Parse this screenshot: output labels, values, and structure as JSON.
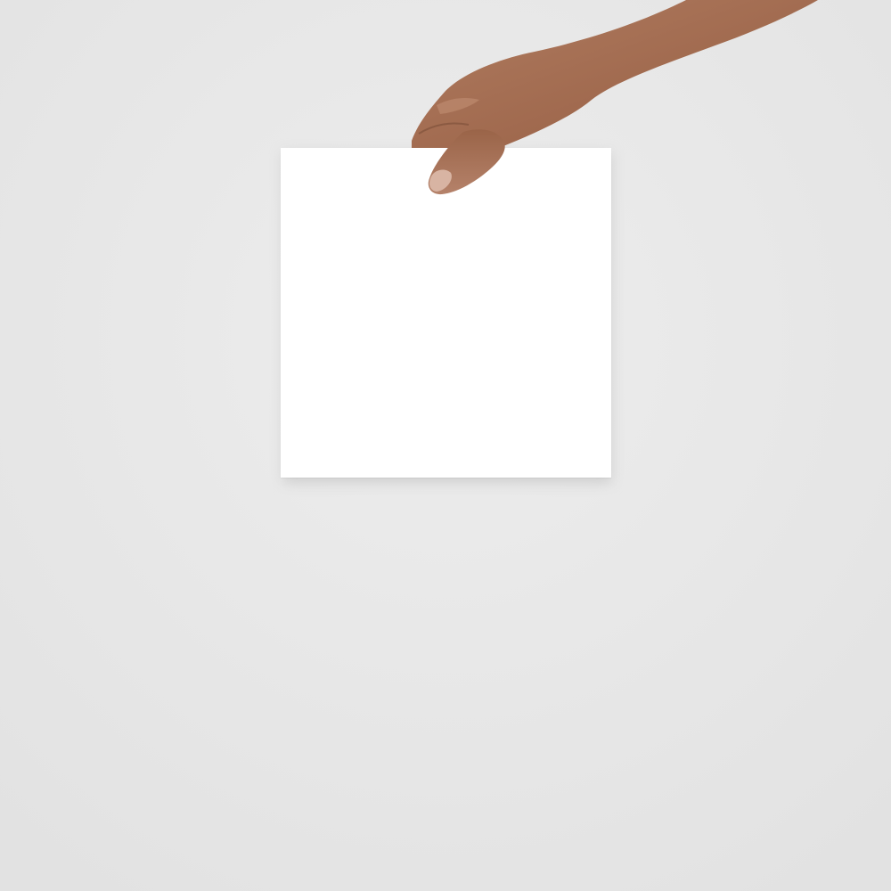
{
  "scene": {
    "subject": "hand-holding-blank-square-paper",
    "colors": {
      "background": "#e8e8e8",
      "background_light": "#ededed",
      "background_dark": "#e2e2e2",
      "paper": "#ffffff",
      "paper_shadow": "#cfcfcf",
      "skin": "#a9765a",
      "skin_dark": "#845740",
      "skin_light": "#c08d70",
      "nail": "#d8b4a3"
    }
  }
}
